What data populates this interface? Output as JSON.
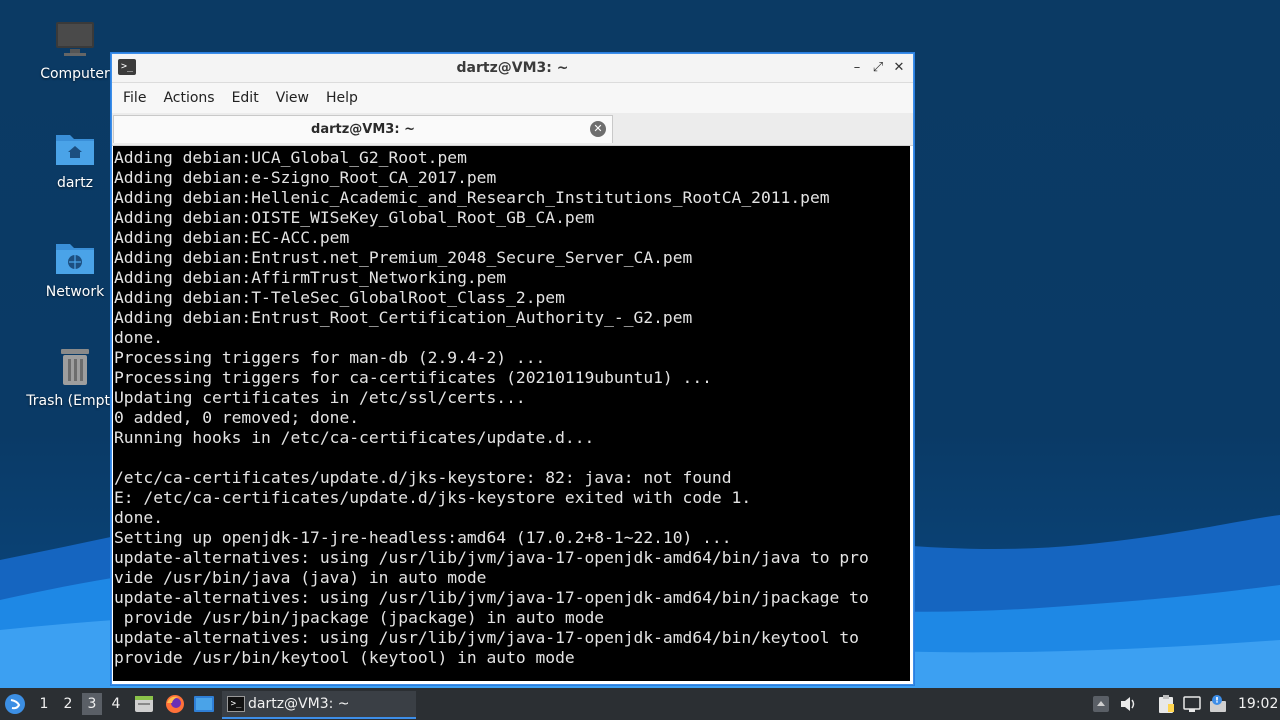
{
  "desktop": {
    "icons": [
      {
        "label": "Computer",
        "icon": "computer-icon"
      },
      {
        "label": "dartz",
        "icon": "home-folder-icon"
      },
      {
        "label": "Network",
        "icon": "network-folder-icon"
      },
      {
        "label": "Trash (Empty)",
        "icon": "trash-icon"
      }
    ]
  },
  "window": {
    "title": "dartz@VM3: ~",
    "controls": {
      "minimize": "–",
      "maximize": "⤢",
      "close": "✕"
    },
    "menu": [
      "File",
      "Actions",
      "Edit",
      "View",
      "Help"
    ],
    "tab": {
      "title": "dartz@VM3: ~",
      "close": "✕"
    },
    "terminal_lines": [
      "Adding debian:UCA_Global_G2_Root.pem",
      "Adding debian:e-Szigno_Root_CA_2017.pem",
      "Adding debian:Hellenic_Academic_and_Research_Institutions_RootCA_2011.pem",
      "Adding debian:OISTE_WISeKey_Global_Root_GB_CA.pem",
      "Adding debian:EC-ACC.pem",
      "Adding debian:Entrust.net_Premium_2048_Secure_Server_CA.pem",
      "Adding debian:AffirmTrust_Networking.pem",
      "Adding debian:T-TeleSec_GlobalRoot_Class_2.pem",
      "Adding debian:Entrust_Root_Certification_Authority_-_G2.pem",
      "done.",
      "Processing triggers for man-db (2.9.4-2) ...",
      "Processing triggers for ca-certificates (20210119ubuntu1) ...",
      "Updating certificates in /etc/ssl/certs...",
      "0 added, 0 removed; done.",
      "Running hooks in /etc/ca-certificates/update.d...",
      "",
      "/etc/ca-certificates/update.d/jks-keystore: 82: java: not found",
      "E: /etc/ca-certificates/update.d/jks-keystore exited with code 1.",
      "done.",
      "Setting up openjdk-17-jre-headless:amd64 (17.0.2+8-1~22.10) ...",
      "update-alternatives: using /usr/lib/jvm/java-17-openjdk-amd64/bin/java to pro",
      "vide /usr/bin/java (java) in auto mode",
      "update-alternatives: using /usr/lib/jvm/java-17-openjdk-amd64/bin/jpackage to",
      " provide /usr/bin/jpackage (jpackage) in auto mode",
      "update-alternatives: using /usr/lib/jvm/java-17-openjdk-amd64/bin/keytool to",
      "provide /usr/bin/keytool (keytool) in auto mode"
    ]
  },
  "taskbar": {
    "workspaces": [
      "1",
      "2",
      "3",
      "4"
    ],
    "active_workspace": "3",
    "launchers": [
      "file-manager-icon",
      "firefox-icon",
      "desktop-icon"
    ],
    "task_label": "dartz@VM3: ~",
    "tray": [
      "volume-icon",
      "clipboard-icon",
      "network-icon",
      "update-notifier-icon"
    ],
    "clock": "19:02"
  },
  "colors": {
    "accent": "#3d8ee8",
    "terminal_bg": "#000000",
    "terminal_fg": "#e3e3e3",
    "taskbar_bg": "#2b2f33"
  }
}
